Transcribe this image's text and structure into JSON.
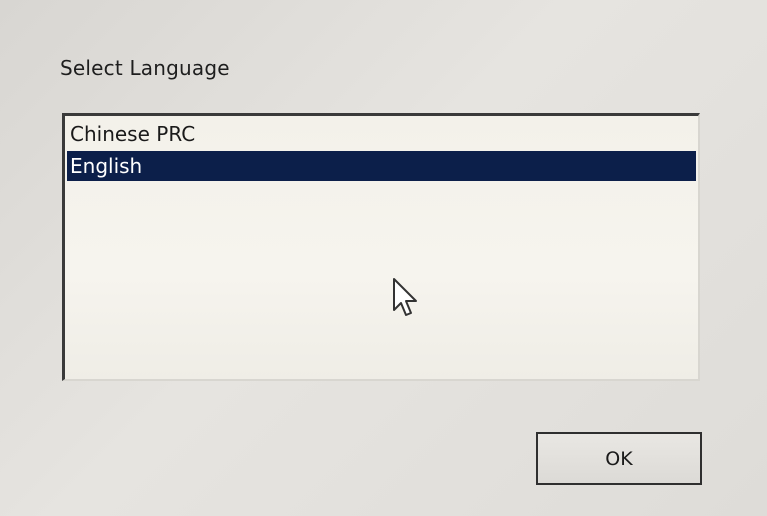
{
  "dialog": {
    "title": "Select Language",
    "languages": [
      {
        "label": "Chinese PRC",
        "selected": false
      },
      {
        "label": "English",
        "selected": true
      }
    ],
    "ok_label": "OK"
  },
  "colors": {
    "selection_background": "#0c1f4a",
    "selection_text": "#ffffff"
  },
  "icons": {
    "cursor": "mouse-pointer-icon"
  }
}
